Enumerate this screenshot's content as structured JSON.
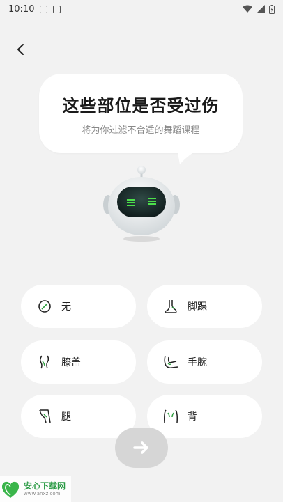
{
  "status_bar": {
    "time": "10:10"
  },
  "question": {
    "title": "这些部位是否受过伤",
    "subtitle": "将为你过滤不合适的舞蹈课程"
  },
  "options": [
    {
      "label": "无",
      "icon": "none-icon"
    },
    {
      "label": "脚踝",
      "icon": "ankle-icon"
    },
    {
      "label": "膝盖",
      "icon": "knee-icon"
    },
    {
      "label": "手腕",
      "icon": "wrist-icon"
    },
    {
      "label": "腿",
      "icon": "leg-icon"
    },
    {
      "label": "背",
      "icon": "back-icon"
    }
  ],
  "watermark": {
    "name": "安心下载网",
    "url": "www.anxz.com"
  },
  "colors": {
    "accent": "#2e9e3f",
    "background": "#f2f2f2",
    "card": "#ffffff",
    "next_button": "#d6d6d6"
  }
}
